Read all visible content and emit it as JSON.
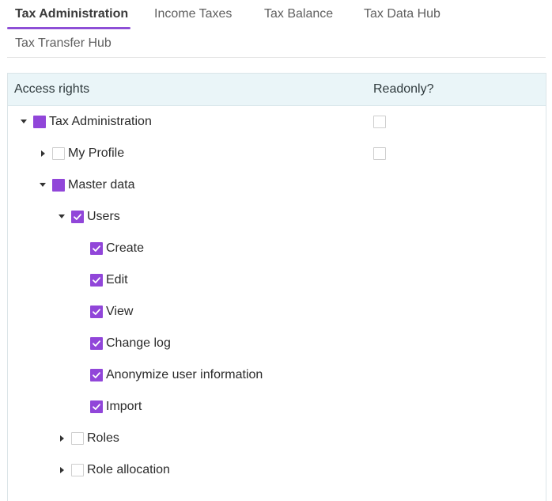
{
  "tabs": [
    {
      "label": "Tax Administration",
      "active": true
    },
    {
      "label": "Income Taxes",
      "active": false
    },
    {
      "label": "Tax Balance",
      "active": false
    },
    {
      "label": "Tax Data Hub",
      "active": false
    },
    {
      "label": "Tax Transfer Hub",
      "active": false
    }
  ],
  "grid": {
    "headers": {
      "access_rights": "Access rights",
      "readonly": "Readonly?"
    },
    "rows": [
      {
        "label": "Tax Administration",
        "level": 0,
        "expander": "expanded",
        "state": "partial",
        "readonly_checkbox": true
      },
      {
        "label": "My Profile",
        "level": 1,
        "expander": "collapsed",
        "state": "unchecked",
        "readonly_checkbox": true
      },
      {
        "label": "Master data",
        "level": 1,
        "expander": "expanded",
        "state": "partial",
        "readonly_checkbox": false
      },
      {
        "label": "Users",
        "level": 2,
        "expander": "expanded",
        "state": "checked",
        "readonly_checkbox": false
      },
      {
        "label": "Create",
        "level": 3,
        "expander": "none",
        "state": "checked",
        "readonly_checkbox": false
      },
      {
        "label": "Edit",
        "level": 3,
        "expander": "none",
        "state": "checked",
        "readonly_checkbox": false
      },
      {
        "label": "View",
        "level": 3,
        "expander": "none",
        "state": "checked",
        "readonly_checkbox": false
      },
      {
        "label": "Change log",
        "level": 3,
        "expander": "none",
        "state": "checked",
        "readonly_checkbox": false
      },
      {
        "label": "Anonymize user information",
        "level": 3,
        "expander": "none",
        "state": "checked",
        "readonly_checkbox": false
      },
      {
        "label": "Import",
        "level": 3,
        "expander": "none",
        "state": "checked",
        "readonly_checkbox": false
      },
      {
        "label": "Roles",
        "level": 2,
        "expander": "collapsed",
        "state": "unchecked",
        "readonly_checkbox": false
      },
      {
        "label": "Role allocation",
        "level": 2,
        "expander": "collapsed",
        "state": "unchecked",
        "readonly_checkbox": false
      }
    ]
  },
  "colors": {
    "accent": "#9146d9",
    "header_bg": "#eaf5f8"
  },
  "icons": {
    "expanded": "caret-down-icon",
    "collapsed": "caret-right-icon",
    "checked": "checkmark-icon"
  }
}
